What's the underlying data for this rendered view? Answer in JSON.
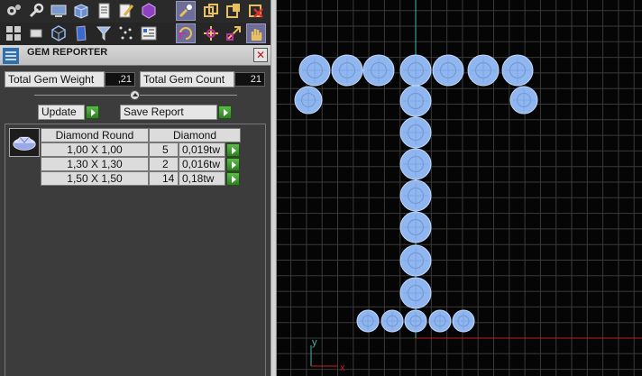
{
  "toolbar": {
    "row1": [
      {
        "icon": "gears-icon",
        "selected": false
      },
      {
        "icon": "wrench-icon",
        "selected": false
      },
      {
        "icon": "monitor-icon",
        "selected": false
      },
      {
        "icon": "box-icon",
        "selected": false
      },
      {
        "icon": "document-icon",
        "selected": false
      },
      {
        "icon": "pencil-icon",
        "selected": false
      },
      {
        "icon": "cube-icon",
        "selected": false
      },
      {
        "icon": "brush-icon",
        "selected": true
      },
      {
        "icon": "copy-transform-icon",
        "selected": false
      },
      {
        "icon": "paste-icon",
        "selected": false
      },
      {
        "icon": "delete-icon",
        "selected": false
      }
    ],
    "row2": [
      {
        "icon": "grid-icon",
        "selected": false
      },
      {
        "icon": "screen-icon",
        "selected": false
      },
      {
        "icon": "wireframe-cube-icon",
        "selected": false
      },
      {
        "icon": "book-icon",
        "selected": false
      },
      {
        "icon": "filter-icon",
        "selected": false
      },
      {
        "icon": "scatter-icon",
        "selected": false
      },
      {
        "icon": "list-panel-icon",
        "selected": false
      },
      {
        "icon": "rotate-icon",
        "selected": true
      },
      {
        "icon": "move-icon",
        "selected": false
      },
      {
        "icon": "scale-icon",
        "selected": false
      },
      {
        "icon": "hand-icon",
        "selected": true
      }
    ]
  },
  "panel": {
    "title": "GEM REPORTER",
    "close_symbol": "✕"
  },
  "summary": {
    "weight_label": "Total Gem Weight",
    "weight_value": ",21",
    "count_label": "Total Gem Count",
    "count_value": "21"
  },
  "actions": {
    "update_label": "Update",
    "save_label": "Save Report"
  },
  "table": {
    "headers": [
      "Diamond Round",
      "Diamond"
    ],
    "rows": [
      {
        "size": "1,00 X 1,00",
        "count": "5",
        "weight": "0,019tw"
      },
      {
        "size": "1,30 X 1,30",
        "count": "2",
        "weight": "0,016tw"
      },
      {
        "size": "1,50 X 1,50",
        "count": "14",
        "weight": "0,18tw"
      }
    ]
  },
  "viewport": {
    "axis_y_label": "y",
    "axis_x_label": "x",
    "background": "#050505",
    "grid_color": "#3a3a3a",
    "gem_color": "#8fb6ee"
  }
}
